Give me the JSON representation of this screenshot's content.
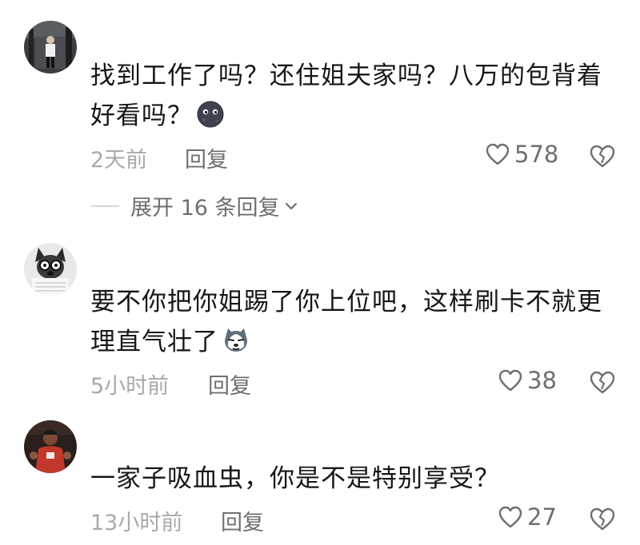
{
  "comments": [
    {
      "text": "找到工作了吗？还住姐夫家吗？八万的包背着好看吗？",
      "emoji": "moon-face-emoji",
      "time": "2天前",
      "reply_label": "回复",
      "likes": "578"
    },
    {
      "text": "要不你把你姐踢了你上位吧，这样刷卡不就更理直气壮了",
      "emoji": "husky-face-emoji",
      "time": "5小时前",
      "reply_label": "回复",
      "likes": "38"
    },
    {
      "text": "一家子吸血虫，你是不是特别享受？",
      "emoji": "",
      "time": "13小时前",
      "reply_label": "回复",
      "likes": "27"
    }
  ],
  "expand_replies": {
    "label": "展开 16 条回复"
  },
  "colors": {
    "text": "#161616",
    "meta": "#a9a9a9",
    "action": "#6f6f6f"
  },
  "icons": [
    "heart-icon",
    "broken-heart-icon",
    "chevron-down-icon"
  ]
}
